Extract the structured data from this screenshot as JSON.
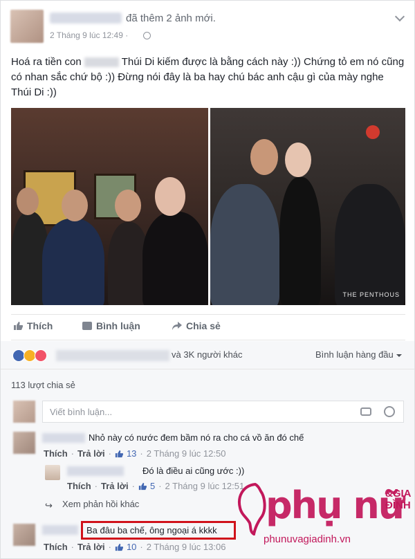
{
  "post": {
    "action_text": "đã thêm 2 ảnh mới.",
    "time": "2 Tháng 9 lúc 12:49 ·",
    "text_before": "Hoá ra tiền con",
    "text_after": "Thúi Di kiếm được là bằng cách này :)) Chứng tỏ em nó cũng có nhan sắc chứ bộ :)) Đừng nói đây là ba hay chú bác anh cậu gì của mày nghe Thúi Di :))",
    "photo_watermark": "THE PENTHOUS"
  },
  "actions": {
    "like": "Thích",
    "comment": "Bình luận",
    "share": "Chia sẻ"
  },
  "reactions": {
    "others": "và 3K người khác",
    "sort": "Bình luận hàng đầu",
    "shares": "113 lượt chia sẻ"
  },
  "composer": {
    "placeholder": "Viết bình luận..."
  },
  "comments": [
    {
      "text": "Nhỏ này có nước đem bầm nó ra cho cá vồ ăn đó chế",
      "like": "Thích",
      "reply": "Trả lời",
      "likes": "13",
      "time": "2 Tháng 9 lúc 12:50"
    },
    {
      "text": "Ba đâu ba chế, ông ngoại á kkkk",
      "like": "Thích",
      "reply": "Trả lời",
      "likes": "10",
      "time": "2 Tháng 9 lúc 13:06"
    }
  ],
  "reply": {
    "text": "Đó là điều ai cũng ước :))",
    "like": "Thích",
    "reply": "Trả lời",
    "likes": "5",
    "time": "2 Tháng 9 lúc 12:51"
  },
  "more_replies": "Xem phản hồi khác",
  "watermark": {
    "brand": "phụ nữ",
    "brand_suffix_1": "&GIA",
    "brand_suffix_2": "ĐÌNH",
    "url": "phunuvagiadinh.vn"
  },
  "colors": {
    "link": "#4267b2",
    "highlight": "#d0121b",
    "watermark": "#c2185b"
  }
}
